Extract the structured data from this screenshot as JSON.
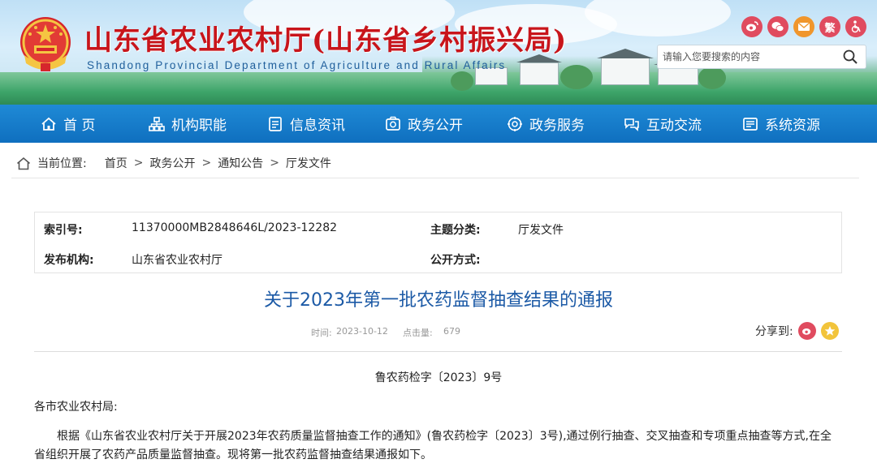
{
  "header": {
    "site_title": "山东省农业农村厅(山东省乡村振兴局)",
    "site_subtitle": "Shandong Provincial Department of Agriculture and Rural Affairs",
    "social": [
      {
        "name": "weibo-icon",
        "glyph": "",
        "color": "#e04b5f"
      },
      {
        "name": "wechat-icon",
        "glyph": "",
        "color": "#e04b5f"
      },
      {
        "name": "mail-icon",
        "glyph": "",
        "color": "#f0962c"
      },
      {
        "name": "traditional-chinese-button",
        "glyph": "繁",
        "color": "#e04b5f"
      },
      {
        "name": "accessibility-icon",
        "glyph": "",
        "color": "#e04b5f"
      }
    ],
    "search_placeholder": "请输入您要搜索的内容"
  },
  "nav": {
    "items": [
      {
        "label": "首 页",
        "icon": "home-icon"
      },
      {
        "label": "机构职能",
        "icon": "org-chart-icon"
      },
      {
        "label": "信息资讯",
        "icon": "document-icon"
      },
      {
        "label": "政务公开",
        "icon": "open-affairs-icon"
      },
      {
        "label": "政务服务",
        "icon": "service-icon"
      },
      {
        "label": "互动交流",
        "icon": "interaction-icon"
      },
      {
        "label": "系统资源",
        "icon": "system-resources-icon"
      }
    ]
  },
  "breadcrumb": {
    "label": "当前位置:",
    "items": [
      "首页",
      "政务公开",
      "通知公告",
      "厅发文件"
    ],
    "separator": ">"
  },
  "meta": {
    "index_label": "索引号:",
    "index_value": "11370000MB2848646L/2023-12282",
    "category_label": "主题分类:",
    "category_value": "厅发文件",
    "publisher_label": "发布机构:",
    "publisher_value": "山东省农业农村厅",
    "disclosure_label": "公开方式:",
    "disclosure_value": ""
  },
  "article": {
    "title": "关于2023年第一批农药监督抽查结果的通报",
    "time_label": "时间:",
    "time_value": "2023-10-12",
    "clicks_label": "点击量:",
    "clicks_value": "679",
    "share_label": "分享到:",
    "doc_number": "鲁农药检字〔2023〕9号",
    "greeting": "各市农业农村局:",
    "paragraph": "根据《山东省农业农村厅关于开展2023年农药质量监督抽查工作的通知》(鲁农药检字〔2023〕3号),通过例行抽查、交叉抽查和专项重点抽查等方式,在全省组织开展了农药产品质量监督抽查。现将第一批农药监督抽查结果通报如下。"
  }
}
